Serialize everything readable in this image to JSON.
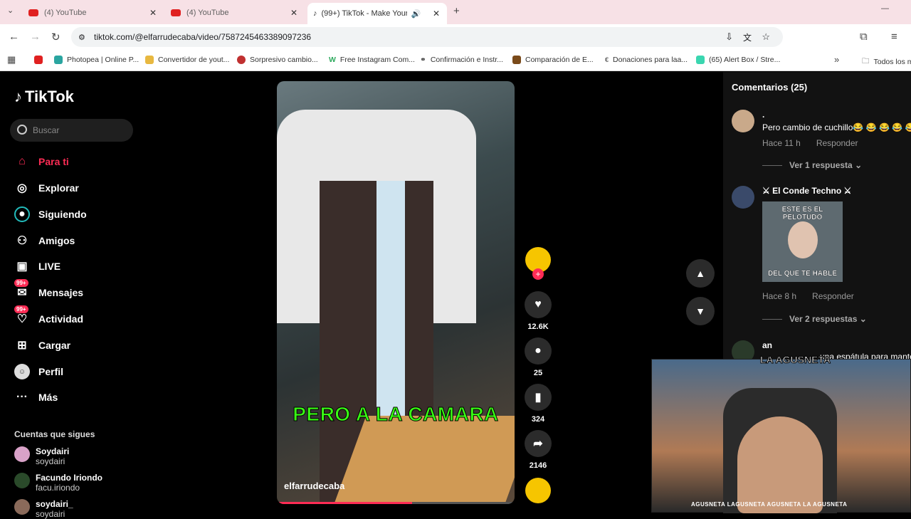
{
  "browser": {
    "tabs": [
      {
        "label": "(4) YouTube"
      },
      {
        "label": "(4) YouTube"
      },
      {
        "label": "(99+) TikTok - Make Your Da"
      }
    ],
    "url": "tiktok.com/@elfarrudecaba/video/7587245463389097236",
    "bookmarks": [
      {
        "label": "Photopea | Online P..."
      },
      {
        "label": "Convertidor de yout..."
      },
      {
        "label": "Sorpresivo cambio..."
      },
      {
        "label": "Free Instagram Com..."
      },
      {
        "label": "Confirmación e Instr..."
      },
      {
        "label": "Comparación de E..."
      },
      {
        "label": "Donaciones para laa..."
      },
      {
        "label": "(65) Alert Box / Stre..."
      },
      {
        "label": "Todos los m"
      }
    ]
  },
  "sidebar": {
    "logo": "TikTok",
    "search_placeholder": "Buscar",
    "nav": [
      {
        "label": "Para ti",
        "icon": "home-icon"
      },
      {
        "label": "Explorar",
        "icon": "compass-icon"
      },
      {
        "label": "Siguiendo",
        "icon": "following-icon"
      },
      {
        "label": "Amigos",
        "icon": "friends-icon"
      },
      {
        "label": "LIVE",
        "icon": "live-icon"
      },
      {
        "label": "Mensajes",
        "icon": "messages-icon",
        "badge": "99+"
      },
      {
        "label": "Actividad",
        "icon": "activity-icon",
        "badge": "99+"
      },
      {
        "label": "Cargar",
        "icon": "upload-icon"
      },
      {
        "label": "Perfil",
        "icon": "profile-icon"
      },
      {
        "label": "Más",
        "icon": "more-icon"
      }
    ],
    "following_title": "Cuentas que sigues",
    "following": [
      {
        "name": "Soydairi",
        "handle": "soydairi"
      },
      {
        "name": "Facundo Iriondo",
        "handle": "facu.iriondo"
      },
      {
        "name": "soydairi_",
        "handle": "soydairi"
      }
    ]
  },
  "video": {
    "caption": "PERO A LA CAMARA",
    "author": "elfarrudecaba",
    "progress": 0.57
  },
  "actions": {
    "likes": "12.6K",
    "comments": "25",
    "saves": "324",
    "shares": "2146"
  },
  "comments": {
    "title": "Comentarios (25)",
    "items": [
      {
        "user": ".",
        "text": "Pero cambio de cuchillo😂 😂 😂 😂 😂",
        "time": "Hace 11 h",
        "reply": "Responder",
        "view_replies": "Ver 1 respuesta"
      },
      {
        "user": "⚔ El Conde Techno ⚔",
        "meme_top": "ESTE ES EL PELOTUDO",
        "meme_bottom": "DEL QUE TE HABLE",
        "time": "Hace 8 h",
        "reply": "Responder",
        "view_replies": "Ver 2 respuestas"
      },
      {
        "user": "an",
        "text": "una espátula para mantec"
      }
    ]
  },
  "webcam": {
    "brand": "LA AGUSNETA",
    "socials": "AGUSNETA  LAGUSNETA  AGUSNETA  LA AGUSNETA"
  },
  "colors": {
    "accent": "#fe2c55",
    "caption": "#39ff14"
  }
}
